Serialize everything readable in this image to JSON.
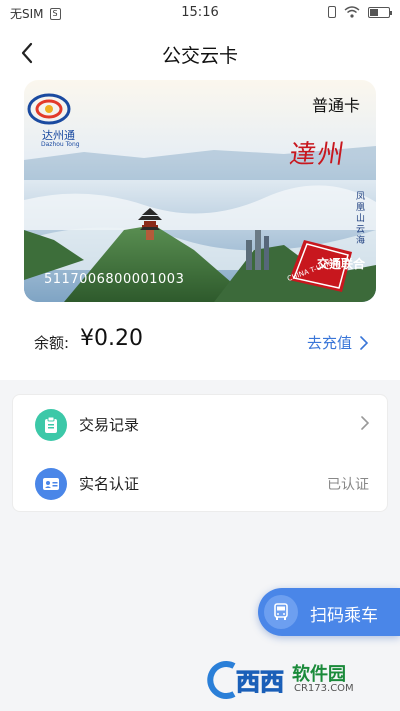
{
  "status_bar": {
    "carrier": "无SIM",
    "sim_icon": "sim-card-icon",
    "time": "15:16",
    "icons": [
      "vibrate-icon",
      "wifi-icon",
      "battery-icon"
    ]
  },
  "header": {
    "title": "公交云卡",
    "back_icon": "chevron-left-icon"
  },
  "card": {
    "logo_text": "达州通",
    "logo_subtext": "Dazhou Tong",
    "type": "普通卡",
    "city_calligraphy": "達州",
    "scenery_caption": "凤凰山云海",
    "number": "5117006800001003",
    "union_logo_cn": "交通联合",
    "union_logo_en": "CHINA T-UNION"
  },
  "balance": {
    "label": "余额:",
    "value": "¥0.20",
    "recharge_label": "去充值"
  },
  "menu": [
    {
      "label": "交易记录",
      "icon": "clipboard-icon",
      "icon_color": "#3cc8a8",
      "right_text": ""
    },
    {
      "label": "实名认证",
      "icon": "id-card-icon",
      "icon_color": "#4a86e8",
      "right_text": "已认证"
    }
  ],
  "scan_button": {
    "label": "扫码乘车",
    "icon": "bus-icon"
  },
  "watermark": {
    "text": "西西",
    "brand": "软件园",
    "url": "CR173.COM"
  },
  "colors": {
    "accent": "#4a86e8",
    "link": "#3a76d8",
    "page_bg": "#f4f5f7"
  }
}
